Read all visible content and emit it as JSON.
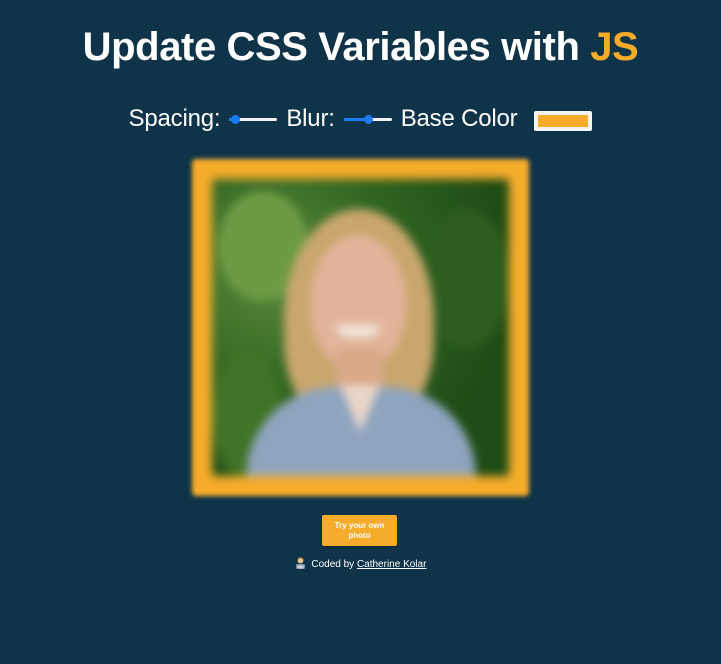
{
  "header": {
    "title_prefix": "Update CSS Variables with",
    "title_highlight": "JS"
  },
  "controls": {
    "spacing": {
      "label": "Spacing:",
      "value_fraction": 0.12
    },
    "blur": {
      "label": "Blur:",
      "value_fraction": 0.5
    },
    "base_color": {
      "label": "Base Color",
      "value": "#f6ac2a"
    }
  },
  "photo": {
    "subject": "blurred portrait photo with colored frame",
    "frame_color": "#f6ac2a"
  },
  "upload_button": {
    "label": "Try your own photo"
  },
  "footer": {
    "icon": "woman-technologist-emoji",
    "prefix": "Coded by",
    "author": "Catherine Kolar"
  },
  "colors": {
    "background": "#0f3449",
    "accent": "#f6ac2a",
    "slider_blue": "#1a7cf0"
  }
}
